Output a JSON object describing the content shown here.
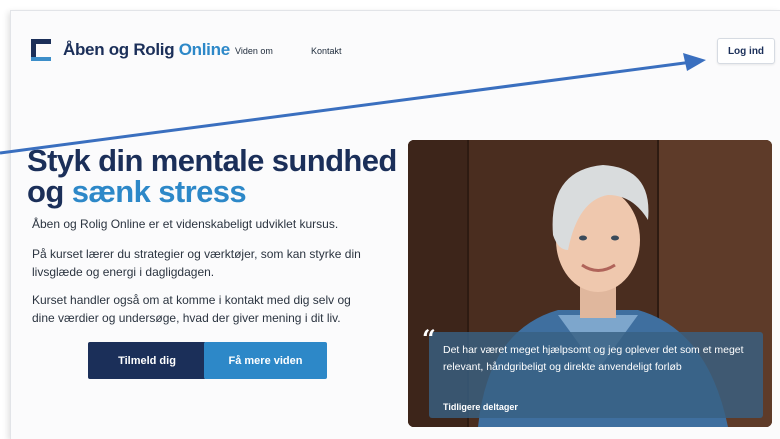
{
  "header": {
    "logo_part1": "Åben og Rolig",
    "logo_part2": "Online",
    "nav": [
      "Viden om",
      "Kontakt"
    ],
    "login_label": "Log ind"
  },
  "hero": {
    "headline_line1": "Styk din mentale sundhed",
    "headline_line2_a": "og ",
    "headline_line2_b": "sænk stress",
    "para1": "Åben og Rolig Online er et videnskabeligt udviklet kursus.",
    "para2_line1": "På kurset lærer du strategier og værktøjer, som kan styrke din",
    "para2_line2": "livsglæde og energi i dagligdagen.",
    "para3_line1": "Kurset handler også om at komme i kontakt med dig selv og",
    "para3_line2": "dine værdier og undersøge, hvad der giver mening i dit liv.",
    "primary_button": "Tilmeld dig",
    "secondary_button": "Få mere viden"
  },
  "testimonial": {
    "quote_mark": "“",
    "quote": "Det har været meget hjælpsomt og jeg oplever det som et meget relevant, håndgribeligt og direkte anvendeligt forløb",
    "author": "Tidligere deltager"
  },
  "colors": {
    "brand_dark": "#1b2f59",
    "brand_accent": "#2d88c8",
    "annotation_arrow": "#3a6fbf"
  }
}
